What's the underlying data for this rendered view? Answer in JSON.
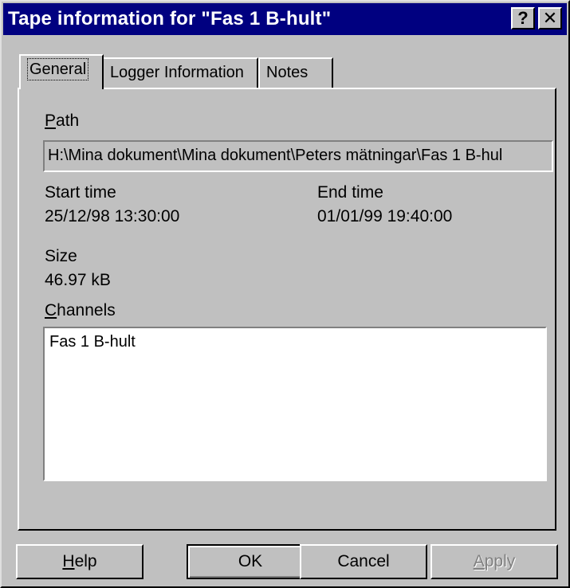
{
  "window": {
    "title": "Tape information for \"Fas 1 B-hult\"",
    "help_glyph": "?",
    "close_glyph": "✕"
  },
  "tabs": [
    {
      "label": "General",
      "active": true
    },
    {
      "label": "Logger Information",
      "active": false
    },
    {
      "label": "Notes",
      "active": false
    }
  ],
  "general": {
    "path_label_first": "P",
    "path_label_rest": "ath",
    "path_value": "H:\\Mina dokument\\Mina dokument\\Peters mätningar\\Fas 1 B-hul",
    "start_time_label": "Start time",
    "start_time_value": "25/12/98 13:30:00",
    "end_time_label": "End time",
    "end_time_value": "01/01/99 19:40:00",
    "size_label": "Size",
    "size_value": "46.97 kB",
    "channels_label_first": "C",
    "channels_label_rest": "hannels",
    "channels": [
      "Fas 1 B-hult"
    ]
  },
  "buttons": {
    "help_first": "H",
    "help_rest": "elp",
    "ok": "OK",
    "cancel": "Cancel",
    "apply_first": "A",
    "apply_rest": "pply"
  },
  "colors": {
    "titlebar": "#000080",
    "face": "#c0c0c0"
  }
}
